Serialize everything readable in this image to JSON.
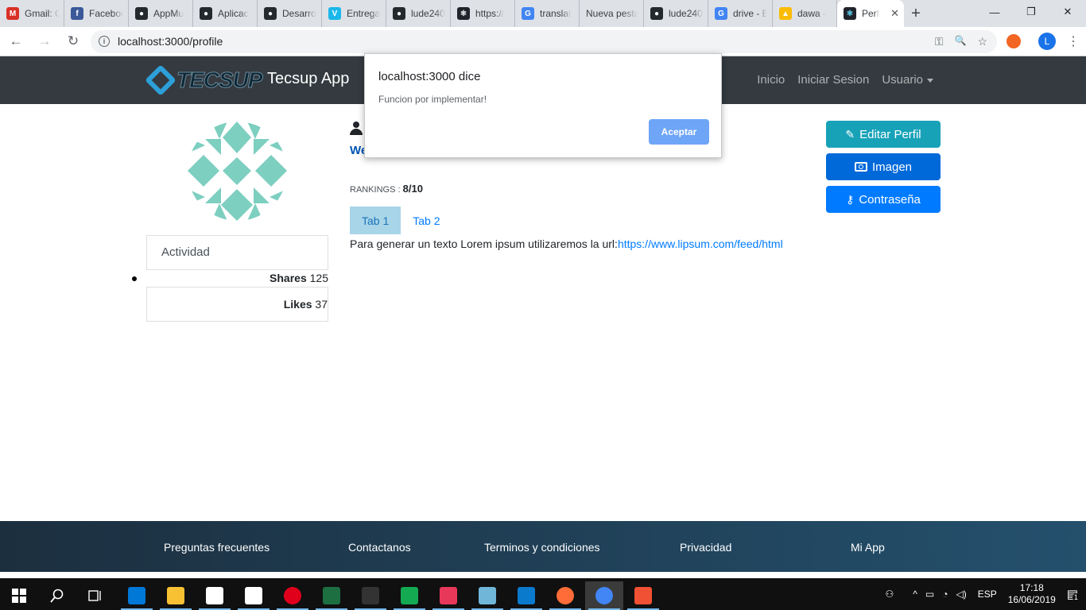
{
  "browser": {
    "tabs": [
      {
        "label": "Gmail: C",
        "icon": "gmail-icon",
        "color": "#d93025",
        "glyph": "M"
      },
      {
        "label": "Faceboo",
        "icon": "facebook-icon",
        "color": "#3b5998",
        "glyph": "f"
      },
      {
        "label": "AppMu",
        "icon": "github-icon",
        "color": "#24292e",
        "glyph": "●"
      },
      {
        "label": "Aplicac",
        "icon": "github-icon",
        "color": "#24292e",
        "glyph": "●"
      },
      {
        "label": "Desarro",
        "icon": "github-icon",
        "color": "#24292e",
        "glyph": "●"
      },
      {
        "label": "Entrega",
        "icon": "vimeo-icon",
        "color": "#1ab7ea",
        "glyph": "V"
      },
      {
        "label": "lude240",
        "icon": "github-icon",
        "color": "#24292e",
        "glyph": "●"
      },
      {
        "label": "https://",
        "icon": "react-icon",
        "color": "#20232a",
        "glyph": "⚛"
      },
      {
        "label": "translat",
        "icon": "google-icon",
        "color": "#4285f4",
        "glyph": "G"
      },
      {
        "label": "Nueva pesta",
        "icon": "none",
        "color": "",
        "glyph": ""
      },
      {
        "label": "lude240",
        "icon": "github-icon",
        "color": "#24292e",
        "glyph": "●"
      },
      {
        "label": "drive - E",
        "icon": "google-icon",
        "color": "#4285f4",
        "glyph": "G"
      },
      {
        "label": "dawa -",
        "icon": "drive-icon",
        "color": "#fbbc04",
        "glyph": "▲"
      }
    ],
    "active_tab": {
      "label": "Perf",
      "icon": "react-icon",
      "close": "✕"
    },
    "new_tab": "+",
    "window_controls": {
      "minimize": "—",
      "restore": "❐",
      "close": "✕"
    },
    "nav": {
      "back": "←",
      "forward": "→",
      "reload": "↻"
    },
    "url": "localhost:3000/profile",
    "profile_initial": "L",
    "omni_icons": {
      "key": "⚿",
      "zoom": "🔍",
      "star": "☆"
    },
    "menu": "⋮"
  },
  "app": {
    "logo_text": "TECSUP",
    "brand": "Tecsup App",
    "nav": {
      "inicio": "Inicio",
      "login": "Iniciar Sesion",
      "user": "Usuario"
    }
  },
  "profile": {
    "welcome": "We",
    "rankings_label": "RANKINGS :",
    "rankings_value": "8/10",
    "actividad": "Actividad",
    "shares_label": "Shares",
    "shares_value": "125",
    "likes_label": "Likes",
    "likes_value": "37",
    "tabs": [
      "Tab 1",
      "Tab 2"
    ],
    "lorem_text": "Para generar un texto Lorem ipsum utilizaremos la url:",
    "lorem_link": "https://www.lipsum.com/feed/html",
    "buttons": {
      "edit": "Editar Perfil",
      "image": "Imagen",
      "password": "Contraseña"
    },
    "colors": {
      "edit": "#17a2b8",
      "image": "#0069d9",
      "password": "#007bff",
      "avatar": "#7dcfc0"
    }
  },
  "dialog": {
    "title": "localhost:3000 dice",
    "message": "Funcion por implementar!",
    "ok": "Aceptar"
  },
  "footer": {
    "links": [
      "Preguntas frecuentes",
      "Contactanos",
      "Terminos y condiciones",
      "Privacidad",
      "Mi App"
    ]
  },
  "taskbar": {
    "apps": [
      {
        "icon": "edge-icon",
        "color": "#0078d7"
      },
      {
        "icon": "file-explorer-icon",
        "color": "#f8c133"
      },
      {
        "icon": "store-icon",
        "color": "#ffffff"
      },
      {
        "icon": "mail-icon",
        "color": "#ffffff"
      },
      {
        "icon": "opera-icon",
        "color": "#e0001b"
      },
      {
        "icon": "excel-icon",
        "color": "#1d6f42"
      },
      {
        "icon": "terminal-icon",
        "color": "#333333"
      },
      {
        "icon": "mongodb-icon",
        "color": "#13aa52"
      },
      {
        "icon": "screen-recorder-icon",
        "color": "#e8385a"
      },
      {
        "icon": "notes-icon",
        "color": "#6fb6d9"
      },
      {
        "icon": "vscode-icon",
        "color": "#0a7acc"
      },
      {
        "icon": "postman-icon",
        "color": "#ff6c37"
      },
      {
        "icon": "chrome-icon",
        "color": "#4285f4"
      },
      {
        "icon": "git-icon",
        "color": "#f05033"
      }
    ],
    "lang": "ESP",
    "time": "17:18",
    "date": "16/06/2019",
    "notifications": "1"
  }
}
